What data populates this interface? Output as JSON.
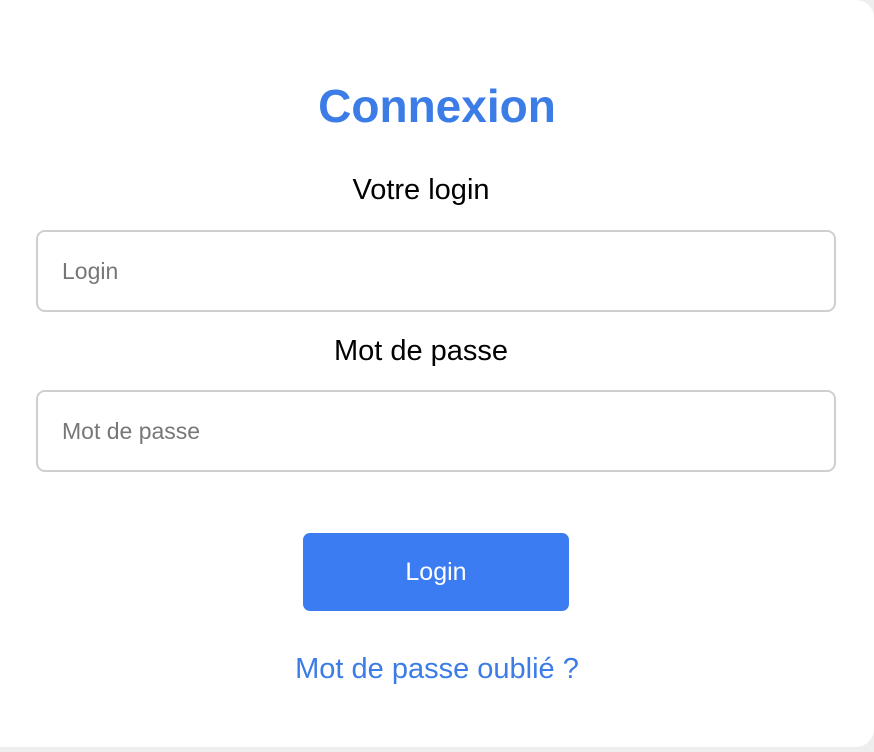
{
  "form": {
    "title": "Connexion",
    "login_label": "Votre login",
    "login_placeholder": "Login",
    "login_value": "",
    "password_label": "Mot de passe",
    "password_placeholder": "Mot de passe",
    "password_value": "",
    "submit_label": "Login",
    "forgot_link": "Mot de passe oublié ?"
  },
  "colors": {
    "accent": "#3b7ce6",
    "button": "#3b7cf3",
    "input_border": "#cfcfcf"
  }
}
